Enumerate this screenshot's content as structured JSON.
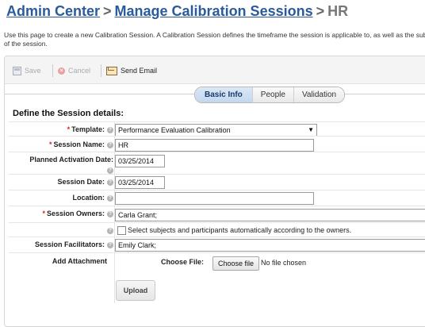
{
  "breadcrumb": {
    "admin_center": "Admin Center",
    "separator": ">",
    "manage_sessions": "Manage Calibration Sessions",
    "current": "HR"
  },
  "intro": "Use this page to create a new Calibration Session. A Calibration Session defines the timeframe the session is applicable to, as well as the subjects of the session.",
  "toolbar": {
    "save_label": "Save",
    "cancel_label": "Cancel",
    "send_email_label": "Send Email"
  },
  "tabs": [
    {
      "label": "Basic Info",
      "active": true
    },
    {
      "label": "People",
      "active": false
    },
    {
      "label": "Validation",
      "active": false
    }
  ],
  "section_title": "Define the Session details:",
  "form": {
    "template": {
      "label": "Template:",
      "value": "Performance Evaluation Calibration",
      "required": true
    },
    "session_name": {
      "label": "Session Name:",
      "value": "HR",
      "required": true
    },
    "planned_activation_date": {
      "label": "Planned Activation Date:",
      "value": "03/25/2014"
    },
    "session_date": {
      "label": "Session Date:",
      "value": "03/25/2014"
    },
    "location": {
      "label": "Location:",
      "value": ""
    },
    "session_owners": {
      "label": "Session Owners:",
      "value": "Carla Grant;",
      "required": true
    },
    "auto_select": {
      "label": "Select subjects and participants automatically according to the owners.",
      "checked": false
    },
    "session_facilitators": {
      "label": "Session Facilitators:",
      "value": "Emily Clark;"
    },
    "add_attachment": {
      "label": "Add Attachment",
      "choose_file_label": "Choose File:",
      "choose_file_button": "Choose file",
      "no_file_text": "No file chosen",
      "upload_button": "Upload"
    }
  },
  "colors": {
    "breadcrumb_link": "#2a5a9a",
    "required_star": "#dd2222",
    "active_tab": "#c2d7ef"
  }
}
